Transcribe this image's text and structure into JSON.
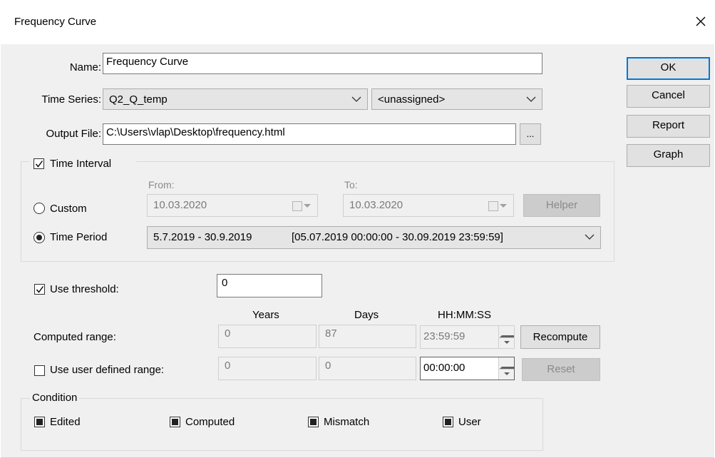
{
  "window": {
    "title": "Frequency Curve"
  },
  "form": {
    "name_label": "Name:",
    "name_value": "Frequency Curve",
    "timeseries_label": "Time Series:",
    "timeseries_value": "Q2_Q_temp",
    "timeseries_second_value": "<unassigned>",
    "output_label": "Output File:",
    "output_value": "C:\\Users\\vlap\\Desktop\\frequency.html",
    "browse_label": "..."
  },
  "buttons": {
    "ok": "OK",
    "cancel": "Cancel",
    "report": "Report",
    "graph": "Graph"
  },
  "time_interval": {
    "label": "Time Interval",
    "checked": true,
    "custom_label": "Custom",
    "from_label": "From:",
    "to_label": "To:",
    "from_value": "10.03.2020",
    "to_value": "10.03.2020",
    "helper_label": "Helper",
    "period_label": "Time Period",
    "period_short": "5.7.2019 - 30.9.2019",
    "period_long": "[05.07.2019 00:00:00 - 30.09.2019 23:59:59]",
    "selected": "Time Period"
  },
  "threshold": {
    "label": "Use threshold:",
    "checked": true,
    "value": "0"
  },
  "range": {
    "col_years": "Years",
    "col_days": "Days",
    "col_hms": "HH:MM:SS",
    "computed_label": "Computed range:",
    "computed_years": "0",
    "computed_days": "87",
    "computed_hms": "23:59:59",
    "recompute_label": "Recompute",
    "user_label": "Use user defined range:",
    "user_checked": false,
    "user_years": "0",
    "user_days": "0",
    "user_hms": "00:00:00",
    "reset_label": "Reset"
  },
  "condition": {
    "label": "Condition",
    "items": [
      {
        "label": "Edited"
      },
      {
        "label": "Computed"
      },
      {
        "label": "Mismatch"
      },
      {
        "label": "User"
      }
    ]
  }
}
